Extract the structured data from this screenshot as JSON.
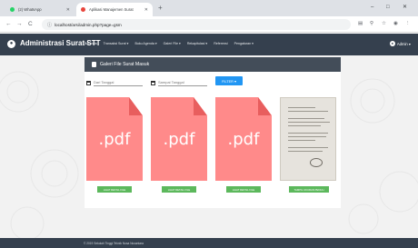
{
  "browser": {
    "tabs": [
      {
        "title": "(2) WhatsApp",
        "icon": "whatsapp-icon",
        "color": "#25d366"
      },
      {
        "title": "Aplikasi Manajemen Surat",
        "icon": "page-favicon-icon",
        "color": "#e8453c"
      }
    ],
    "new_tab": "+",
    "window_controls": {
      "minimize": "–",
      "maximize": "□",
      "close": "✕"
    },
    "url": "localhost/arsi/admin.php?page=gsm",
    "nav": {
      "back": "←",
      "forward": "→",
      "reload": "C"
    }
  },
  "app": {
    "brand": "Administrasi Surat STT",
    "menu": [
      "Beranda",
      "Transaksi Surat ▾",
      "Buku Agenda ▾",
      "Galeri File ▾",
      "Rekapitulasi ▾",
      "Referensi",
      "Pengaturan ▾"
    ],
    "user": "Admin ▾",
    "accent": "#35404e"
  },
  "gallery": {
    "title": "Galeri File Surat Masuk",
    "filter": {
      "from_placeholder": "Dari Tanggal",
      "to_placeholder": "Sampai Tanggal",
      "button": "FILTER ▾"
    },
    "cards": [
      {
        "kind": "pdf",
        "label": ".pdf",
        "button": "LIHAT DETAIL FILE"
      },
      {
        "kind": "pdf",
        "label": ".pdf",
        "button": "LIHAT DETAIL FILE"
      },
      {
        "kind": "pdf",
        "label": ".pdf",
        "button": "LIHAT DETAIL FILE"
      },
      {
        "kind": "image",
        "label": "",
        "button": "TAMPIL UKURAN PENUH"
      }
    ],
    "pdf_color": "#ff8a8a",
    "button_color": "#5cb85c"
  },
  "footer": {
    "text": "© 2019 Sekolah Tinggi Teknik Nusa Nusantara"
  }
}
